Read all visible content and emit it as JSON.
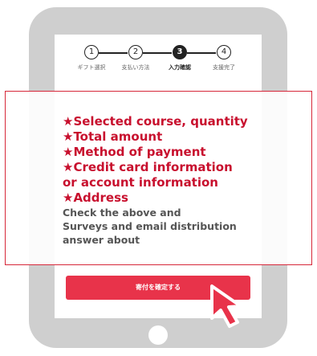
{
  "stepper": {
    "steps": [
      {
        "number": "1",
        "label": "ギフト選択",
        "active": false
      },
      {
        "number": "2",
        "label": "支払い方法",
        "active": false
      },
      {
        "number": "3",
        "label": "入力確認",
        "active": true
      },
      {
        "number": "4",
        "label": "支援完了",
        "active": false
      }
    ]
  },
  "annotation": {
    "red_lines": [
      "★Selected course, quantity",
      "★Total amount",
      "★Method of payment",
      "★Credit card information",
      "or account information",
      "★Address"
    ],
    "gray_lines": [
      "Check the above and",
      "Surveys and email distribution",
      "answer about"
    ]
  },
  "confirm_button": {
    "label": "寄付を確定する"
  },
  "colors": {
    "accent_red": "#e8334a",
    "annotation_red": "#c8102e",
    "tablet_gray": "#cfcfcf"
  }
}
